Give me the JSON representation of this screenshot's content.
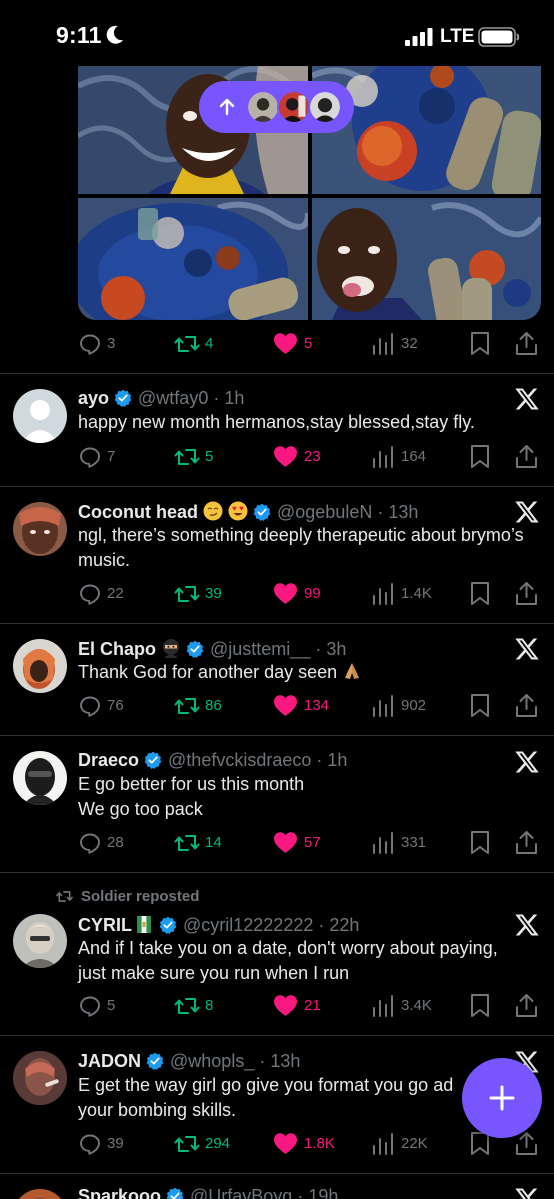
{
  "status_bar": {
    "time": "9:11",
    "network": "LTE"
  },
  "new_posts_pill": {
    "avatars": [
      "avatar-1",
      "avatar-2",
      "avatar-3"
    ]
  },
  "media_tweet": {
    "replies": "3",
    "reposts": "4",
    "likes": "5",
    "views": "32"
  },
  "tweets": [
    {
      "name": "ayo",
      "handle": "@wtfay0",
      "time": "1h",
      "text": "happy new month hermanos,stay blessed,stay fly.",
      "replies": "7",
      "reposts": "5",
      "likes": "23",
      "views": "164"
    },
    {
      "name": "Coconut head",
      "handle": "@ogebuleN",
      "time": "13h",
      "text": "ngl, there’s something deeply therapeutic about brymo’s music.",
      "replies": "22",
      "reposts": "39",
      "likes": "99",
      "views": "1.4K"
    },
    {
      "name": "El Chapo",
      "handle": "@justtemi__",
      "time": "3h",
      "text": "Thank God for another day seen",
      "replies": "76",
      "reposts": "86",
      "likes": "134",
      "views": "902"
    },
    {
      "name": "Draeco",
      "handle": "@thefvckisdraeco",
      "time": "1h",
      "line1": "E go better for us this month",
      "line2": "We go too pack",
      "replies": "28",
      "reposts": "14",
      "likes": "57",
      "views": "331"
    },
    {
      "reposted_by": "Soldier reposted",
      "name": "CYRIL",
      "handle": "@cyril12222222",
      "time": "22h",
      "text": "And if I take you on a date, don't worry about paying, just make sure you run when I run",
      "replies": "5",
      "reposts": "8",
      "likes": "21",
      "views": "3.4K"
    },
    {
      "name": "JADON",
      "handle": "@whopls_",
      "time": "13h",
      "text": "E get the way girl go give you format you go ad your bombing skills.",
      "replies": "39",
      "reposts": "294",
      "likes": "1.8K",
      "views": "22K"
    },
    {
      "name": "Sparkooo",
      "handle": "@UrfavBoyg",
      "time": "19h"
    }
  ],
  "colors": {
    "accent": "#7856ff",
    "like": "#f91880",
    "repost": "#00ba7c",
    "verified": "#1d9bf0",
    "muted": "#71767b"
  },
  "icons": [
    "moon-icon",
    "signal-icon",
    "battery-icon",
    "arrow-up-icon",
    "reply-icon",
    "repost-icon",
    "heart-icon",
    "views-icon",
    "bookmark-icon",
    "share-icon",
    "verified-icon",
    "x-logo-icon",
    "plus-icon"
  ]
}
